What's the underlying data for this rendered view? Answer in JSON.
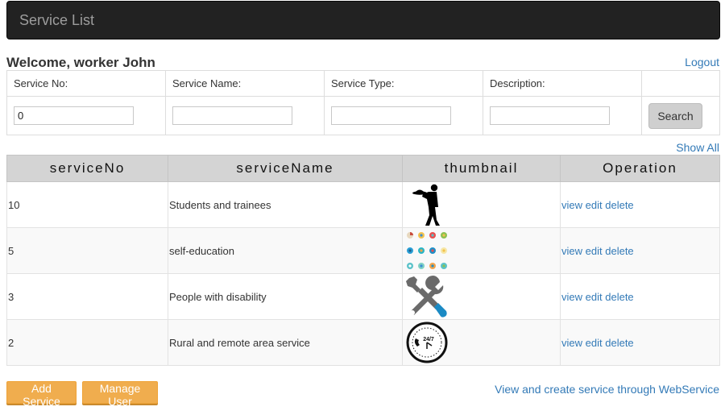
{
  "navbar": {
    "brand": "Service List"
  },
  "header": {
    "welcome": "Welcome,  worker John",
    "logout": "Logout"
  },
  "search": {
    "labels": [
      "Service No:",
      "Service Name:",
      "Service Type:",
      "Description:",
      ""
    ],
    "service_no_value": "0",
    "service_name_value": "",
    "service_type_value": "",
    "description_value": "",
    "search_button": "Search"
  },
  "show_all": "Show All",
  "table": {
    "columns": [
      "serviceNo",
      "serviceName",
      "thumbnail",
      "Operation"
    ],
    "rows": [
      {
        "serviceNo": "10",
        "serviceName": "Students and trainees",
        "thumbnail": "waiter-icon",
        "op_view": "view",
        "op_edit": "edit",
        "op_delete": "delete"
      },
      {
        "serviceNo": "5",
        "serviceName": "self-education",
        "thumbnail": "education-icon-grid",
        "op_view": "view",
        "op_edit": "edit",
        "op_delete": "delete"
      },
      {
        "serviceNo": "3",
        "serviceName": "People with disability",
        "thumbnail": "tools-icon",
        "op_view": "view",
        "op_edit": "edit",
        "op_delete": "delete"
      },
      {
        "serviceNo": "2",
        "serviceName": "Rural and remote area service",
        "thumbnail": "clock-24-7-icon",
        "op_view": "view",
        "op_edit": "edit",
        "op_delete": "delete"
      }
    ]
  },
  "footer": {
    "add_service": "Add Service",
    "manage_user": "Manage User",
    "webservice_link": "View and create service through WebService"
  },
  "clock_text": "24/7",
  "colors": {
    "link": "#337ab7",
    "navbar": "#222222",
    "orange": "#f0ad4e",
    "header_bg": "#d4d4d4"
  }
}
